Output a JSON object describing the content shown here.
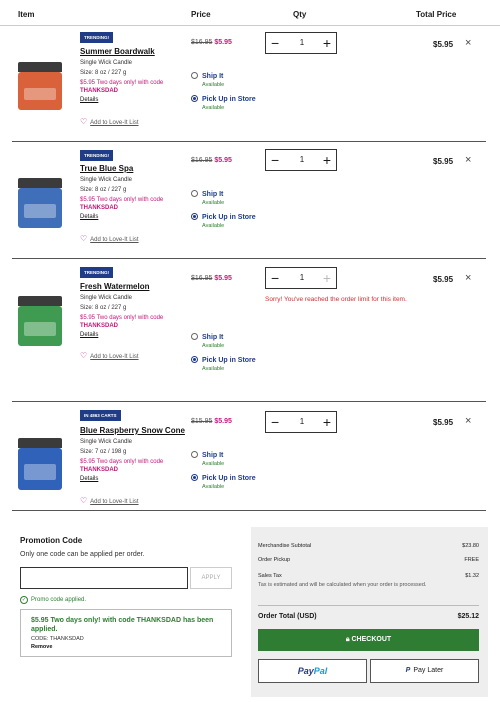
{
  "header": {
    "item": "Item",
    "price": "Price",
    "qty": "Qty",
    "total": "Total Price"
  },
  "common": {
    "ship_it": "Ship It",
    "pick_up": "Pick Up in Store",
    "available": "Available",
    "details": "Details",
    "love_it": "Add to Love-It List",
    "qty_minus": "−",
    "qty_plus": "+",
    "remove": "×"
  },
  "items": [
    {
      "badge": "TRENDING!",
      "name": "Summer Boardwalk",
      "type": "Single Wick Candle",
      "size": "Size: 8 oz / 227 g",
      "promo": "$5.95 Two days only! with code",
      "code": "THANKSDAD",
      "old_price": "$16.95",
      "new_price": "$5.95",
      "qty": "1",
      "total": "$5.95",
      "fulfillment_selected": "Pick Up in Store",
      "jar_color": "#d9623a"
    },
    {
      "badge": "TRENDING!",
      "name": "True Blue Spa",
      "type": "Single Wick Candle",
      "size": "Size: 8 oz / 227 g",
      "promo": "$5.95 Two days only! with code",
      "code": "THANKSDAD",
      "old_price": "$16.95",
      "new_price": "$5.95",
      "qty": "1",
      "total": "$5.95",
      "fulfillment_selected": "Pick Up in Store",
      "jar_color": "#3f6fb8"
    },
    {
      "badge": "TRENDING!",
      "name": "Fresh Watermelon",
      "type": "Single Wick Candle",
      "size": "Size: 8 oz / 227 g",
      "promo": "$5.95 Two days only! with code",
      "code": "THANKSDAD",
      "old_price": "$16.95",
      "new_price": "$5.95",
      "qty": "1",
      "total": "$5.95",
      "limit_msg": "Sorry! You've reached the order limit for this item.",
      "fulfillment_selected": "Pick Up in Store",
      "jar_color": "#3f9a52"
    },
    {
      "badge": "IN 4863 CARTS",
      "name": "Blue Raspberry Snow Cone",
      "type": "Single Wick Candle",
      "size": "Size: 7 oz / 198 g",
      "promo": "$5.95 Two days only! with code",
      "code": "THANKSDAD",
      "old_price": "$15.95",
      "new_price": "$5.95",
      "qty": "1",
      "total": "$5.95",
      "fulfillment_selected": "Pick Up in Store",
      "jar_color": "#2f62b8"
    }
  ],
  "promo": {
    "title": "Promotion Code",
    "note": "Only one code can be applied per order.",
    "input_value": "",
    "apply": "APPLY",
    "applied_msg": "Promo code applied.",
    "applied_desc": "$5.95 Two days only! with code THANKSDAD has been applied.",
    "code_line": "CODE: THANKSDAD",
    "remove": "Remove"
  },
  "summary": {
    "subtotal_label": "Merchandise Subtotal",
    "subtotal": "$23.80",
    "pickup_label": "Order Pickup",
    "pickup": "FREE",
    "tax_label": "Sales Tax",
    "tax": "$1.32",
    "tax_note": "Tax is estimated and will be calculated when your order is processed.",
    "total_label": "Order Total (USD)",
    "total": "$25.12",
    "checkout": "CHECKOUT",
    "paypal_1": "Pay",
    "paypal_2": "Pal",
    "paylater_icon": "P",
    "paylater": "Pay Later"
  },
  "colors": {
    "brand_blue": "#1f3c88",
    "sale_pink": "#c2187a",
    "checkout_green": "#2e7d32",
    "error_red": "#d32f2f"
  }
}
